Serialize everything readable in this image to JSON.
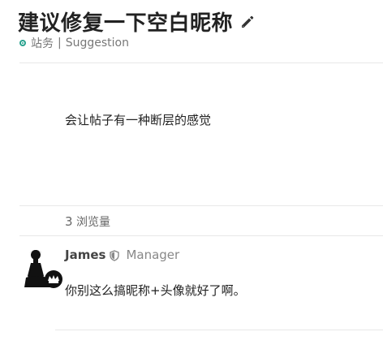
{
  "topic": {
    "title": "建议修复一下空白昵称",
    "category": "站务",
    "tag": "Suggestion",
    "category_color": "#28a28e"
  },
  "post": {
    "body": "会让帖子有一种断层的感觉",
    "views_count": "3",
    "views_label": "浏览量"
  },
  "reply": {
    "author": "James",
    "role": "Manager",
    "body": "你别这么搞昵称+头像就好了啊。"
  }
}
